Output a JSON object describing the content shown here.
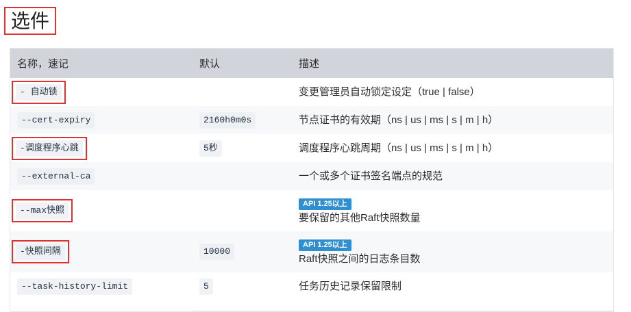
{
  "page": {
    "title": "选件"
  },
  "table": {
    "headers": [
      "名称，速记",
      "默认",
      "描述"
    ],
    "rows": [
      {
        "name": "- 自动锁",
        "default": "",
        "badge": "",
        "description": "变更管理员自动锁定设定（true | false）",
        "highlighted": true
      },
      {
        "name": "--cert-expiry",
        "default": "2160h0m0s",
        "badge": "",
        "description": "节点证书的有效期（ns | us | ms | s | m | h）",
        "highlighted": false
      },
      {
        "name": "-调度程序心跳",
        "default": "5秒",
        "badge": "",
        "description": "调度程序心跳周期（ns | us | ms | s | m | h）",
        "highlighted": true
      },
      {
        "name": "--external-ca",
        "default": "",
        "badge": "",
        "description": "一个或多个证书签名端点的规范",
        "highlighted": false
      },
      {
        "name": "--max快照",
        "default": "",
        "badge": "API 1.25以上",
        "description": "要保留的其他Raft快照数量",
        "highlighted": true
      },
      {
        "name": "-快照间隔",
        "default": "10000",
        "badge": "API 1.25以上",
        "description": "Raft快照之间的日志条目数",
        "highlighted": true
      },
      {
        "name": "--task-history-limit",
        "default": "5",
        "badge": "",
        "description": "任务历史记录保留限制",
        "highlighted": false
      }
    ]
  },
  "colors": {
    "highlight_border": "#e03131",
    "header_bg": "#d1d5db",
    "badge_bg": "#2f8fd1",
    "stripe_bg": "#f6f8fa"
  }
}
